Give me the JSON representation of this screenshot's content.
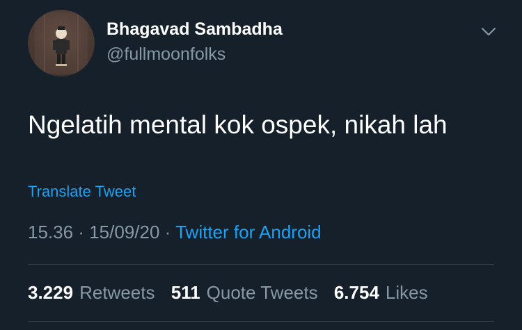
{
  "tweet": {
    "author": {
      "name": "Bhagavad Sambadha",
      "handle": "@fullmoonfolks"
    },
    "text": "Ngelatih mental kok ospek, nikah lah",
    "translate_label": "Translate Tweet",
    "time": "15.36",
    "date": "15/09/20",
    "separator": "·",
    "source": "Twitter for Android",
    "stats": {
      "retweets": {
        "count": "3.229",
        "label": "Retweets"
      },
      "quote_tweets": {
        "count": "511",
        "label": "Quote Tweets"
      },
      "likes": {
        "count": "6.754",
        "label": "Likes"
      }
    }
  },
  "icons": {
    "menu": "chevron-down-icon"
  },
  "colors": {
    "background": "#15202b",
    "primary_text": "#ffffff",
    "secondary_text": "#8899a6",
    "accent": "#1da1f2",
    "divider": "#38444d"
  }
}
